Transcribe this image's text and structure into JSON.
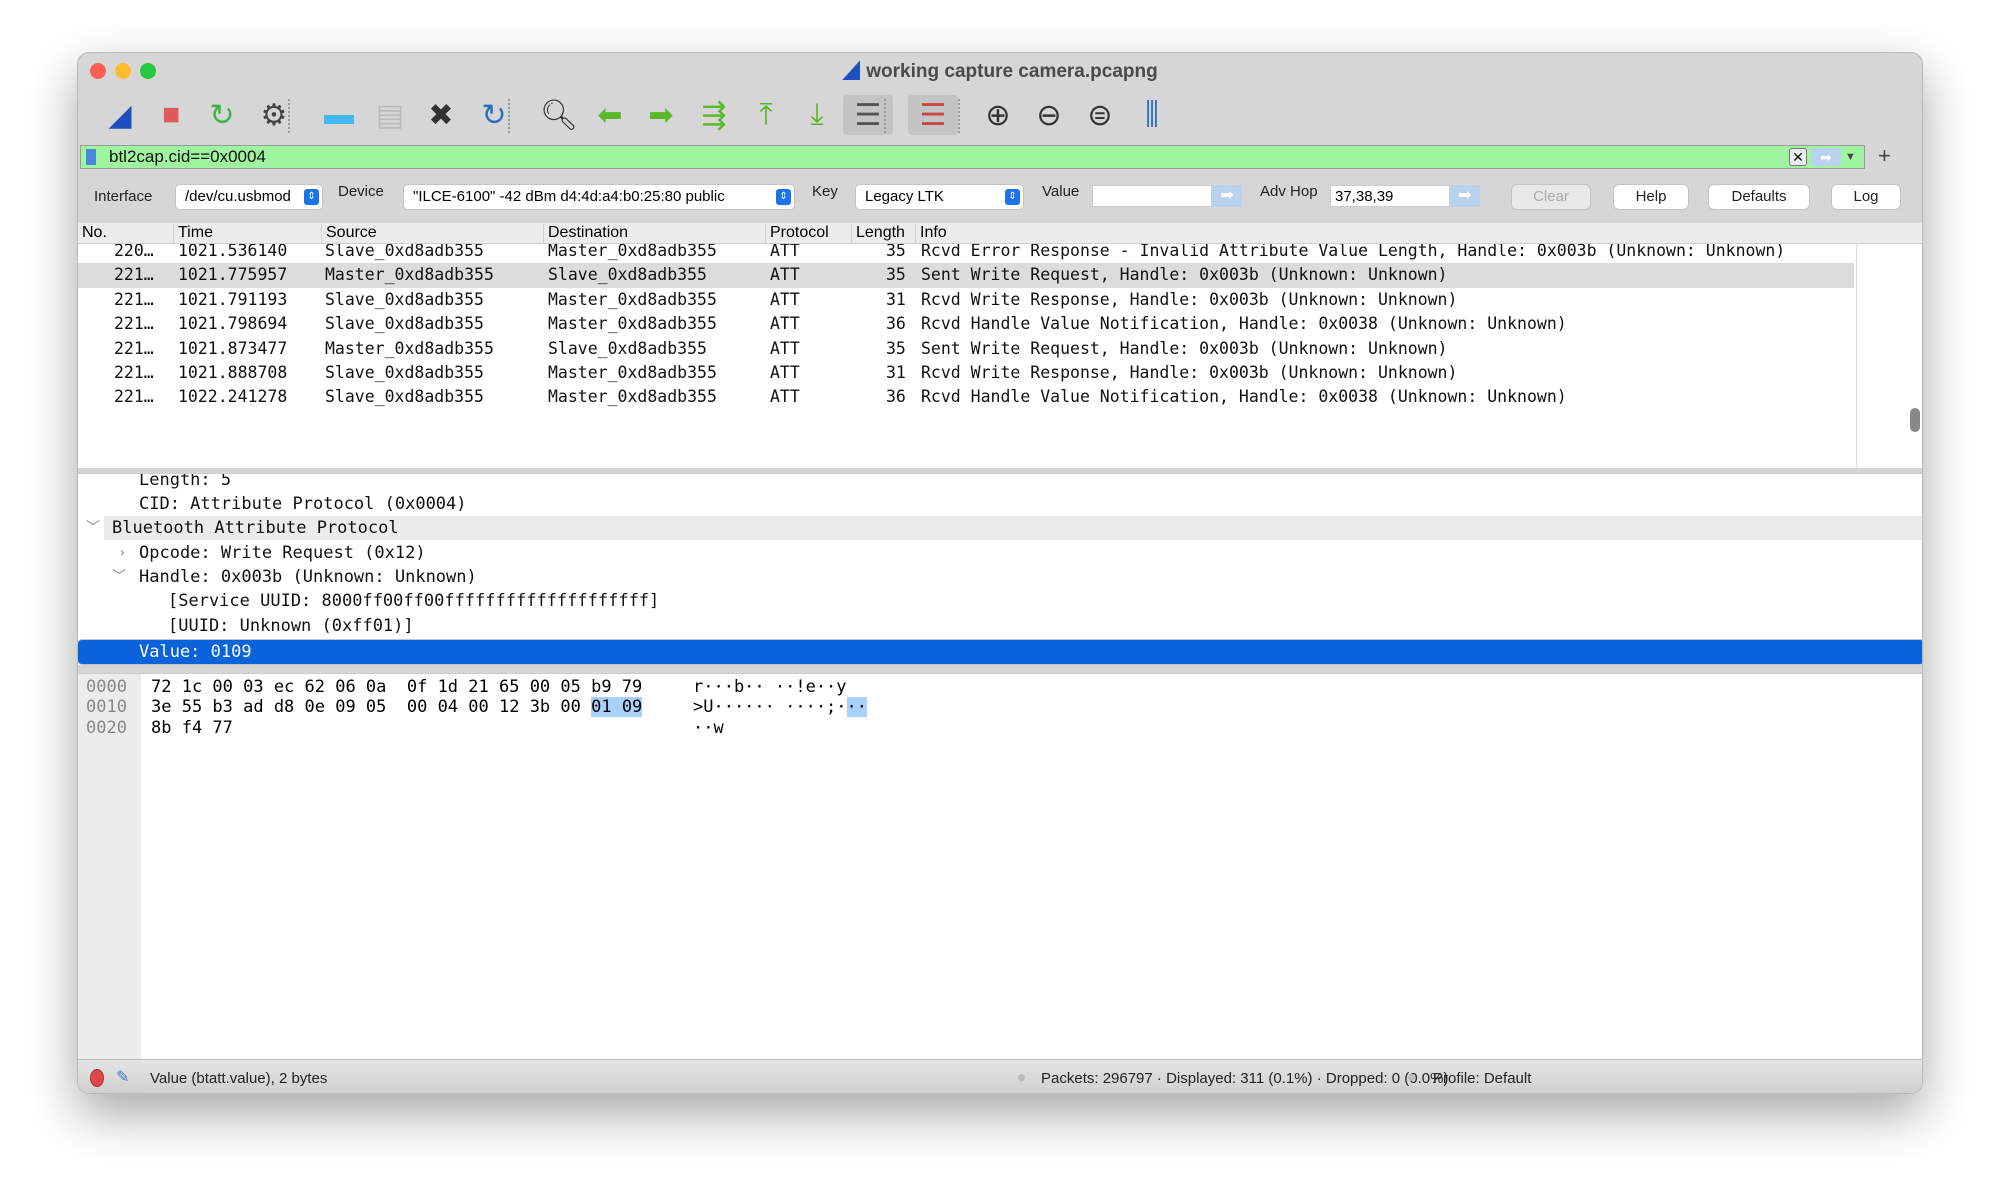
{
  "window": {
    "title": "working capture camera.pcapng"
  },
  "toolbar": {
    "icons": [
      "start-capture-icon",
      "stop-capture-icon",
      "restart-capture-icon",
      "capture-options-icon",
      "open-file-icon",
      "save-file-icon",
      "close-file-icon",
      "reload-file-icon",
      "find-packet-icon",
      "go-back-icon",
      "go-forward-icon",
      "go-to-packet-icon",
      "first-packet-icon",
      "last-packet-icon",
      "auto-scroll-icon",
      "colorize-icon",
      "zoom-in-icon",
      "zoom-out-icon",
      "zoom-normal-icon",
      "resize-columns-icon"
    ]
  },
  "filter": {
    "value": "btl2cap.cid==0x0004",
    "add_label": "+"
  },
  "controls": {
    "interface_label": "Interface",
    "interface_value": "/dev/cu.usbmod",
    "device_label": "Device",
    "device_value": "\"ILCE-6100\"  -42 dBm  d4:4d:a4:b0:25:80  public",
    "key_label": "Key",
    "key_value": "Legacy LTK",
    "value_label": "Value",
    "value_value": "",
    "advhop_label": "Adv Hop",
    "advhop_value": "37,38,39",
    "clear_label": "Clear",
    "help_label": "Help",
    "defaults_label": "Defaults",
    "log_label": "Log"
  },
  "packet_list": {
    "columns": [
      "No.",
      "Time",
      "Source",
      "Destination",
      "Protocol",
      "Length",
      "Info"
    ],
    "rows": [
      {
        "no": "220…",
        "time": "1021.536140",
        "src": "Slave_0xd8adb355",
        "dst": "Master_0xd8adb355",
        "proto": "ATT",
        "len": "35",
        "info": "Rcvd Error Response - Invalid Attribute Value Length, Handle: 0x003b (Unknown: Unknown)"
      },
      {
        "no": "221…",
        "time": "1021.775957",
        "src": "Master_0xd8adb355",
        "dst": "Slave_0xd8adb355",
        "proto": "ATT",
        "len": "35",
        "info": "Sent Write Request, Handle: 0x003b (Unknown: Unknown)"
      },
      {
        "no": "221…",
        "time": "1021.791193",
        "src": "Slave_0xd8adb355",
        "dst": "Master_0xd8adb355",
        "proto": "ATT",
        "len": "31",
        "info": "Rcvd Write Response, Handle: 0x003b (Unknown: Unknown)"
      },
      {
        "no": "221…",
        "time": "1021.798694",
        "src": "Slave_0xd8adb355",
        "dst": "Master_0xd8adb355",
        "proto": "ATT",
        "len": "36",
        "info": "Rcvd Handle Value Notification, Handle: 0x0038 (Unknown: Unknown)"
      },
      {
        "no": "221…",
        "time": "1021.873477",
        "src": "Master_0xd8adb355",
        "dst": "Slave_0xd8adb355",
        "proto": "ATT",
        "len": "35",
        "info": "Sent Write Request, Handle: 0x003b (Unknown: Unknown)"
      },
      {
        "no": "221…",
        "time": "1021.888708",
        "src": "Slave_0xd8adb355",
        "dst": "Master_0xd8adb355",
        "proto": "ATT",
        "len": "31",
        "info": "Rcvd Write Response, Handle: 0x003b (Unknown: Unknown)"
      },
      {
        "no": "221…",
        "time": "1022.241278",
        "src": "Slave_0xd8adb355",
        "dst": "Master_0xd8adb355",
        "proto": "ATT",
        "len": "36",
        "info": "Rcvd Handle Value Notification, Handle: 0x0038 (Unknown: Unknown)"
      }
    ]
  },
  "details": {
    "lines": [
      "Length: 5",
      "CID: Attribute Protocol (0x0004)",
      "Bluetooth Attribute Protocol",
      "Opcode: Write Request (0x12)",
      "Handle: 0x003b (Unknown: Unknown)",
      "[Service UUID: 8000ff00ff00ffffffffffffffffffff]",
      "[UUID: Unknown (0xff01)]",
      "Value: 0109"
    ]
  },
  "hex": {
    "rows": [
      {
        "offset": "0000",
        "hex": "72 1c 00 03 ec 62 06 0a  0f 1d 21 65 00 05 b9 79",
        "hex_sel": "",
        "ascii": "r···b·· ··!e··y",
        "ascii_sel": ""
      },
      {
        "offset": "0010",
        "hex": "3e 55 b3 ad d8 0e 09 05  00 04 00 12 3b 00 ",
        "hex_sel": "01 09",
        "ascii": ">U······ ····;·",
        "ascii_sel": "··"
      },
      {
        "offset": "0020",
        "hex": "8b f4 77",
        "hex_sel": "",
        "ascii": "··w",
        "ascii_sel": ""
      }
    ]
  },
  "status": {
    "field": "Value (btatt.value), 2 bytes",
    "packets": "Packets: 296797 · Displayed: 311 (0.1%) · Dropped: 0 (0.0%)",
    "profile": "Profile: Default"
  },
  "colors": {
    "filter_valid": "#9ff59f",
    "selection": "#0a63db",
    "byte_highlight": "#a8d1fb"
  }
}
